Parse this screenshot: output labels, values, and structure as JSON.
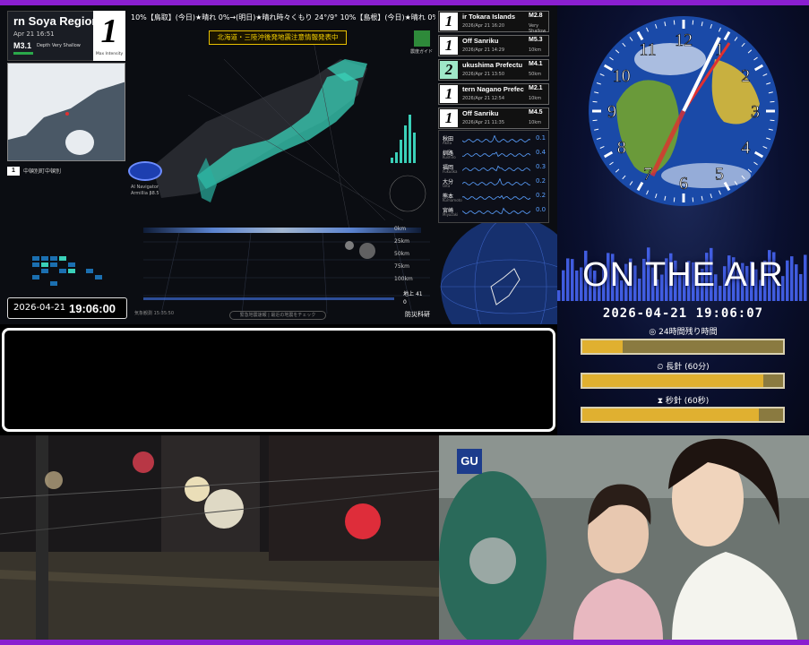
{
  "quake": {
    "region_name": "rn Soya Region",
    "region_time": "Apr 21 16:51",
    "region_mag": "M3.1",
    "region_depth": "Depth Very Shallow",
    "max_intensity": "1",
    "max_intensity_label": "Max Intensity",
    "ticker": "10%【鳥取】(今日)★晴れ 0%→(明日)★晴れ時々くもり 24°/9° 10%【島根】(今日)★晴れ 0%→(明日)★晴れ 0%→",
    "alert": "北海道・三陸沖後発地震注意情報発表中",
    "guide_label": "震度ガイド",
    "minimap_legend_num": "1",
    "minimap_legend_text": "中頓別町中頓別",
    "ai_label": "AI Navigator",
    "ai_sub": "Armillia β8.5",
    "depth_scale": [
      "0km",
      "25km",
      "50km",
      "75km",
      "100km"
    ],
    "kp_label": "地上",
    "kp_value": "41",
    "kp_value2": "0",
    "bosai": "防災科研",
    "bottom_stamp": "気象観測 15:35:50",
    "ops_pill": "緊急地震速報 | 最近の地震をチェック",
    "clock_date": "2026-04-21",
    "clock_time": "19:06:00"
  },
  "quake_list": [
    {
      "int": "1",
      "name": "ir Tokara Islands",
      "time": "2026/Apr 21 16:20",
      "mag": "M2.8",
      "depth": "Very Shallow",
      "green": false
    },
    {
      "int": "1",
      "name": "Off Sanriku",
      "time": "2026/Apr 21 14:29",
      "mag": "M5.3",
      "depth": "10km",
      "green": false
    },
    {
      "int": "2",
      "name": "ukushima Prefectu",
      "time": "2026/Apr 21 13:50",
      "mag": "M4.1",
      "depth": "50km",
      "green": true
    },
    {
      "int": "1",
      "name": "tern Nagano Prefec",
      "time": "2026/Apr 21 12:54",
      "mag": "M2.1",
      "depth": "10km",
      "green": false
    },
    {
      "int": "1",
      "name": "Off Sanriku",
      "time": "2026/Apr 21 11:35",
      "mag": "M4.5",
      "depth": "10km",
      "green": false
    }
  ],
  "observations": [
    {
      "name": "秋田",
      "sub": "Akita",
      "val": "0.1"
    },
    {
      "name": "釧路",
      "sub": "Kushiro",
      "val": "0.4"
    },
    {
      "name": "福岡",
      "sub": "Fukuoka",
      "val": "0.3"
    },
    {
      "name": "大分",
      "sub": "Oita",
      "val": "0.2"
    },
    {
      "name": "熊本",
      "sub": "Kumamoto",
      "val": "0.2"
    },
    {
      "name": "宮崎",
      "sub": "Miyazaki",
      "val": "0.0"
    }
  ],
  "onair": {
    "title": "ON THE AIR",
    "datetime": "2026-04-21 19:06:07",
    "bars": [
      {
        "label": "24時間残り時間",
        "icon": "globe-icon",
        "progress": 0.2
      },
      {
        "label": "長針 (60分)",
        "icon": "clock-icon",
        "progress": 0.9
      },
      {
        "label": "秒針 (60秒)",
        "icon": "hourglass-icon",
        "progress": 0.88
      }
    ],
    "clock_numbers": [
      "12",
      "1",
      "2",
      "3",
      "4",
      "5",
      "6",
      "7",
      "8",
      "9",
      "10",
      "11"
    ]
  },
  "ad": {
    "logo": "GU"
  },
  "colors": {
    "frame": "#8a1fd0",
    "alert": "#f5d000",
    "accent_blue": "#5aa0ff",
    "gold": "#e0b030"
  }
}
